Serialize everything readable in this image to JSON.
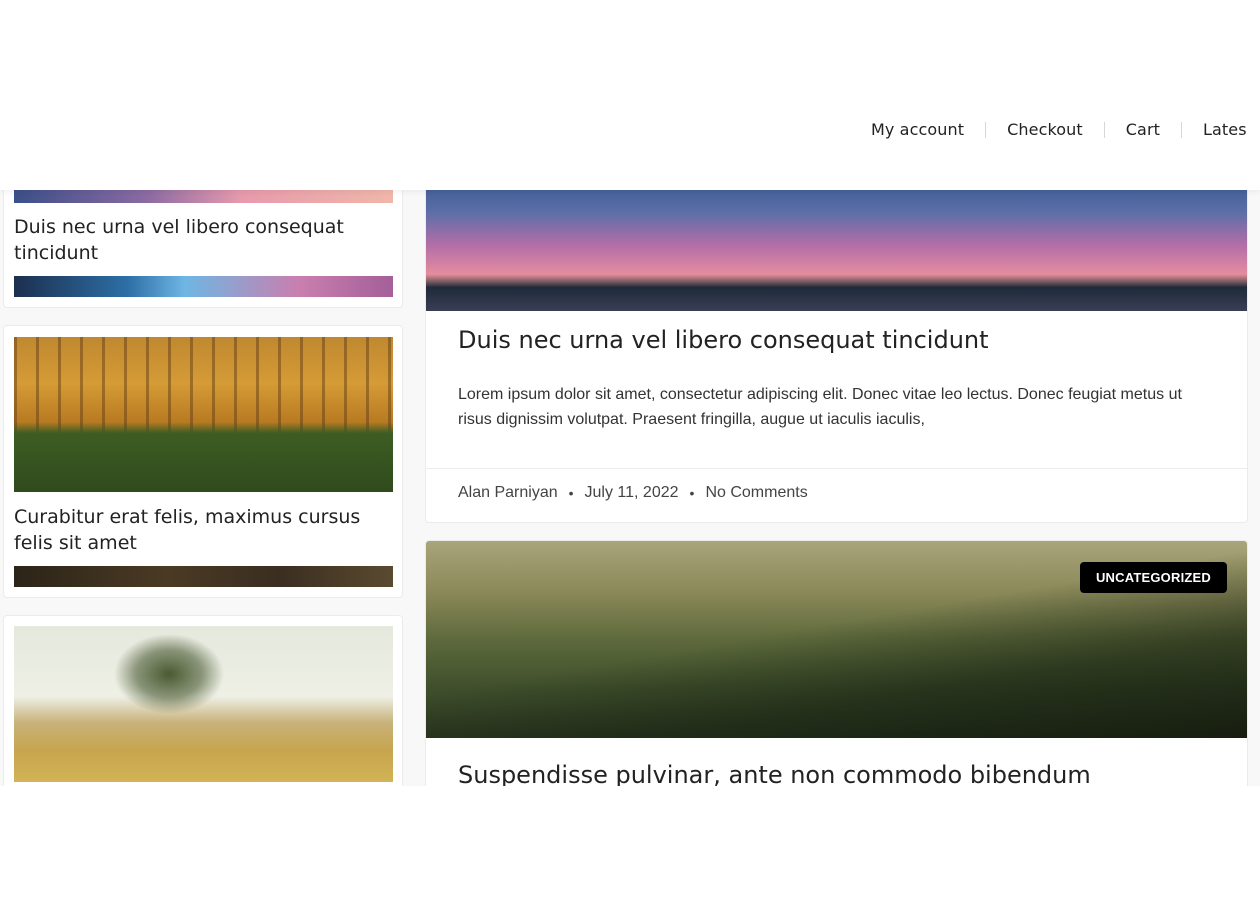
{
  "header": {
    "nav": [
      {
        "label": "My account"
      },
      {
        "label": "Checkout"
      },
      {
        "label": "Cart"
      },
      {
        "label": "Lates"
      }
    ]
  },
  "sidebar": {
    "posts": [
      {
        "title": "Duis nec urna vel libero consequat tincidunt"
      },
      {
        "title": "Curabitur erat felis, maximus cursus felis sit amet"
      },
      {
        "title": ""
      }
    ]
  },
  "main": {
    "posts": [
      {
        "title": "Duis nec urna vel libero consequat tincidunt",
        "excerpt": "Lorem ipsum dolor sit amet, consectetur adipiscing elit. Donec vitae leo lectus. Donec feugiat metus ut risus dignissim volutpat. Praesent fringilla, augue ut iaculis iaculis,",
        "author": "Alan Parniyan",
        "date": "July 11, 2022",
        "comments": "No Comments",
        "separator": "•"
      },
      {
        "title": "Suspendisse pulvinar, ante non commodo bibendum",
        "category": "UNCATEGORIZED"
      }
    ]
  }
}
